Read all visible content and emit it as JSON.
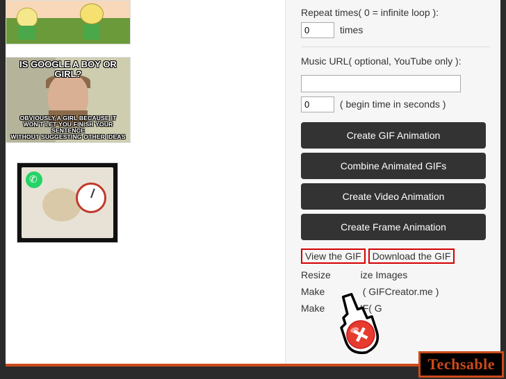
{
  "images": {
    "meme_top": "IS GOOGLE A BOY OR GIRL?",
    "meme_bottom": "OBVIOUSLY A GIRL BECAUSE IT\nWON'T LET YOU FINISH YOUR SENTENCE\nWITHOUT SUGGESTING OTHER IDEAS"
  },
  "options": {
    "repeat_label": "Repeat times( 0 = infinite loop ):",
    "repeat_value": "0",
    "repeat_suffix": "times",
    "music_label": "Music URL( optional, YouTube only ):",
    "music_url": "",
    "begin_value": "0",
    "begin_suffix": "( begin time in seconds )"
  },
  "buttons": {
    "create_gif": "Create GIF Animation",
    "combine_gif": "Combine Animated GIFs",
    "create_video": "Create Video Animation",
    "create_frame": "Create Frame Animation"
  },
  "links": {
    "view_gif": "View the GIF",
    "download_gif": "Download the GIF",
    "resize_tail": "ize Images",
    "resize_lead": "Resize",
    "make2_lead": "Make",
    "make2_tail": "( GIFCreator.me )",
    "make3_lead": "Make",
    "make3_tail": "IF( G"
  },
  "watermark": "Techsable"
}
